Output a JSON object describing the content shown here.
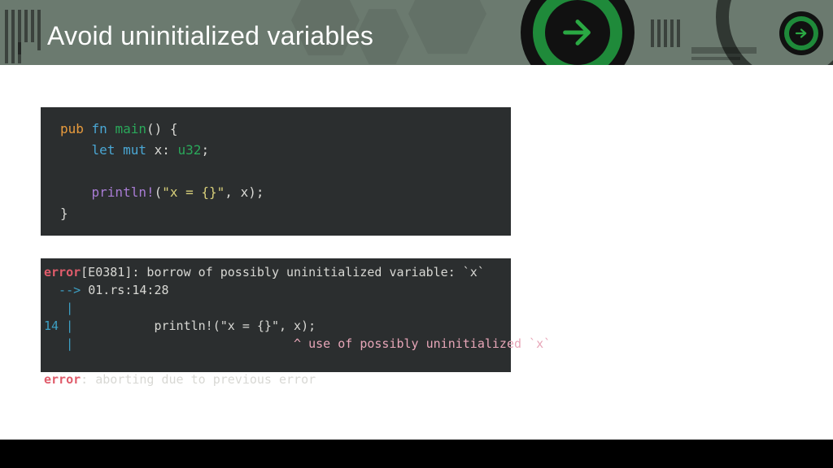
{
  "header": {
    "title": "Avoid uninitialized variables"
  },
  "code": {
    "l1": {
      "pub": "pub",
      "fn": "fn",
      "main": "main",
      "rest": "() {"
    },
    "l2": {
      "indent": "    ",
      "let": "let",
      "mut": "mut",
      "x": "x",
      "colon": ": ",
      "type": "u32",
      "semi": ";"
    },
    "l3": "",
    "l4": {
      "indent": "    ",
      "macro": "println!",
      "open": "(",
      "str": "\"x = {}\"",
      "comma": ", ",
      "arg": "x",
      "close": ");"
    },
    "l5": "}"
  },
  "error": {
    "l1": {
      "err": "error",
      "code": "[E0381]",
      "msg": ": borrow of possibly uninitialized variable: `x`"
    },
    "l2": {
      "arrow": "  --> ",
      "loc": "01.rs:14:28"
    },
    "l3": "   |",
    "l4": {
      "line": "14 |",
      "code": "           println!(\"x = {}\", x);"
    },
    "l5": {
      "pipe": "   |",
      "caret": "                              ^ ",
      "msg": "use of possibly uninitialized `x`"
    },
    "l6": "",
    "l7": {
      "err": "error",
      "msg": ": aborting due to previous error"
    }
  }
}
